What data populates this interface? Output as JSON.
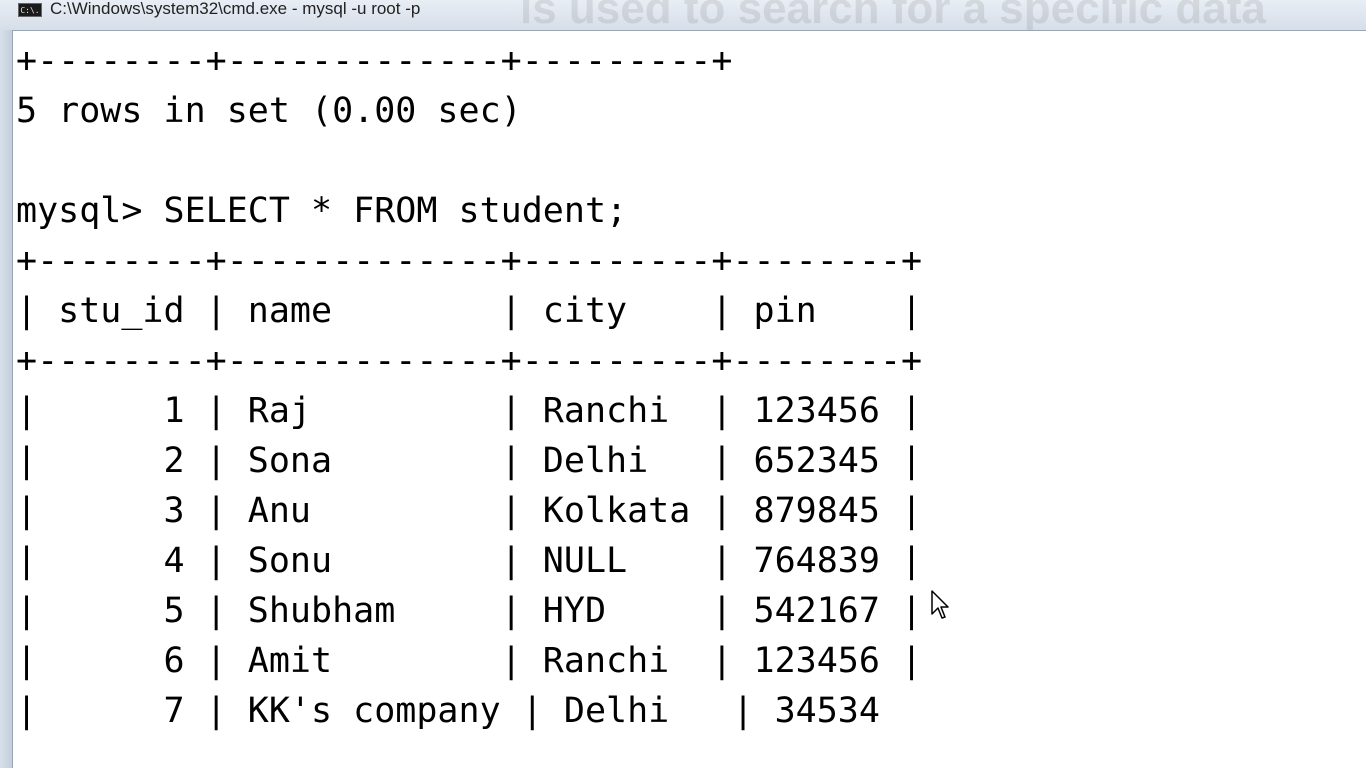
{
  "window": {
    "title": "C:\\Windows\\system32\\cmd.exe - mysql  -u root -p",
    "icon_name": "cmd-icon",
    "icon_text": "C:\\.",
    "background_text": "is used to search for a specific data"
  },
  "terminal": {
    "lines": [
      "+--------+-------------+---------+",
      "5 rows in set (0.00 sec)",
      "",
      "mysql> SELECT * FROM student;",
      "+--------+-------------+---------+--------+",
      "| stu_id | name        | city    | pin    |",
      "+--------+-------------+---------+--------+",
      "|      1 | Raj         | Ranchi  | 123456 |",
      "|      2 | Sona        | Delhi   | 652345 |",
      "|      3 | Anu         | Kolkata | 879845 |",
      "|      4 | Sonu        | NULL    | 764839 |",
      "|      5 | Shubham     | HYD     | 542167 |",
      "|      6 | Amit        | Ranchi  | 123456 |",
      "|      7 | KK's company | Delhi   | 34534"
    ]
  },
  "table": {
    "columns": [
      "stu_id",
      "name",
      "city",
      "pin"
    ],
    "rows": [
      [
        "1",
        "Raj",
        "Ranchi",
        "123456"
      ],
      [
        "2",
        "Sona",
        "Delhi",
        "652345"
      ],
      [
        "3",
        "Anu",
        "Kolkata",
        "879845"
      ],
      [
        "4",
        "Sonu",
        "NULL",
        "764839"
      ],
      [
        "5",
        "Shubham",
        "HYD",
        "542167"
      ],
      [
        "6",
        "Amit",
        "Ranchi",
        "123456"
      ],
      [
        "7",
        "KK's company",
        "Delhi",
        "34534"
      ]
    ]
  },
  "pointer": {
    "icon_name": "mouse-pointer-icon"
  }
}
